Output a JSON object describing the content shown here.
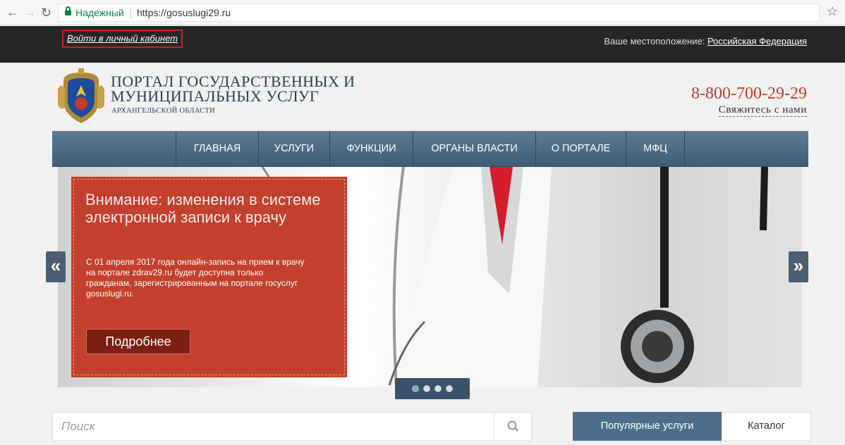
{
  "browser": {
    "secure_label": "Надежный",
    "url": "https://gosuslugi29.ru",
    "icons": [
      "back-arrow-icon",
      "forward-arrow-icon",
      "reload-icon",
      "lock-icon",
      "bookmark-star-icon"
    ]
  },
  "topbar": {
    "login_label": "Войти в личный кабинет",
    "location_label": "Ваше местоположение:",
    "location_value": "Российская Федерация"
  },
  "header": {
    "title_line1": "ПОРТАЛ ГОСУДАРСТВЕННЫХ И",
    "title_line2": "МУНИЦИПАЛЬНЫХ УСЛУГ",
    "region": "АРХАНГЕЛЬСКОЙ ОБЛАСТИ",
    "phone": "8-800-700-29-29",
    "contact_label": "Свяжитесь с нами"
  },
  "nav": {
    "items": [
      {
        "label": "ГЛАВНАЯ"
      },
      {
        "label": "УСЛУГИ"
      },
      {
        "label": "ФУНКЦИИ"
      },
      {
        "label": "ОРГАНЫ ВЛАСТИ"
      },
      {
        "label": "О ПОРТАЛЕ"
      },
      {
        "label": "МФЦ"
      }
    ]
  },
  "slider": {
    "title": "Внимание: изменения в системе электронной записи к врачу",
    "text": "С 01 апреля 2017 года онлайн-запись на прием к врачу на портале zdrav29.ru будет доступна только гражданам, зарегистрированным на портале госуслуг gosuslugi.ru.",
    "more_label": "Подробнее",
    "prev_glyph": "«",
    "next_glyph": "»",
    "slide_count": 4
  },
  "search": {
    "placeholder": "Поиск"
  },
  "tabs": {
    "popular_label": "Популярные услуги",
    "catalog_label": "Каталог"
  },
  "colors": {
    "accent_red": "#c3402e",
    "nav_blue": "#4c6e8c",
    "phone_red": "#c43c2c",
    "highlight_red": "#d6182a"
  }
}
